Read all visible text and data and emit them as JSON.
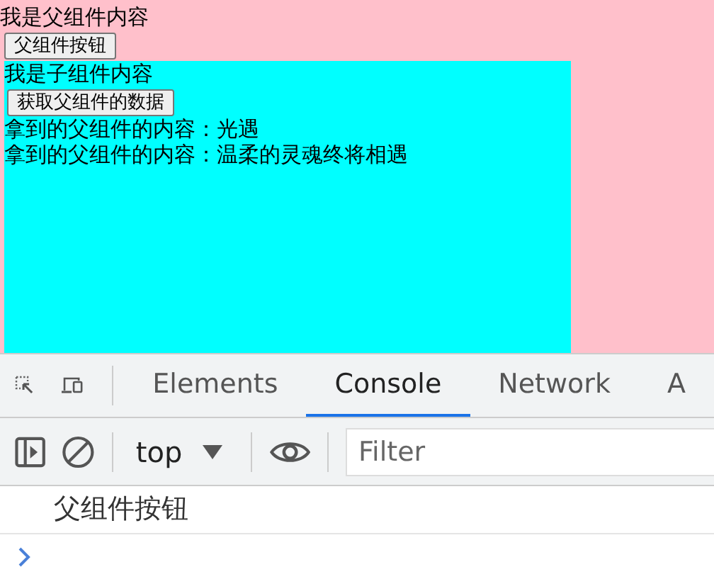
{
  "parent": {
    "text": "我是父组件内容",
    "button": "父组件按钮"
  },
  "child": {
    "text": "我是子组件内容",
    "button": "获取父组件的数据",
    "lines": [
      "拿到的父组件的内容：光遇",
      "拿到的父组件的内容：温柔的灵魂终将相遇"
    ]
  },
  "devtools": {
    "tabs": [
      {
        "label": "Elements",
        "selected": false
      },
      {
        "label": "Console",
        "selected": true
      },
      {
        "label": "Network",
        "selected": false
      },
      {
        "label": "A",
        "selected": false
      }
    ],
    "context": "top",
    "filter": {
      "placeholder": "Filter"
    },
    "messages": [
      "父组件按钮"
    ]
  }
}
